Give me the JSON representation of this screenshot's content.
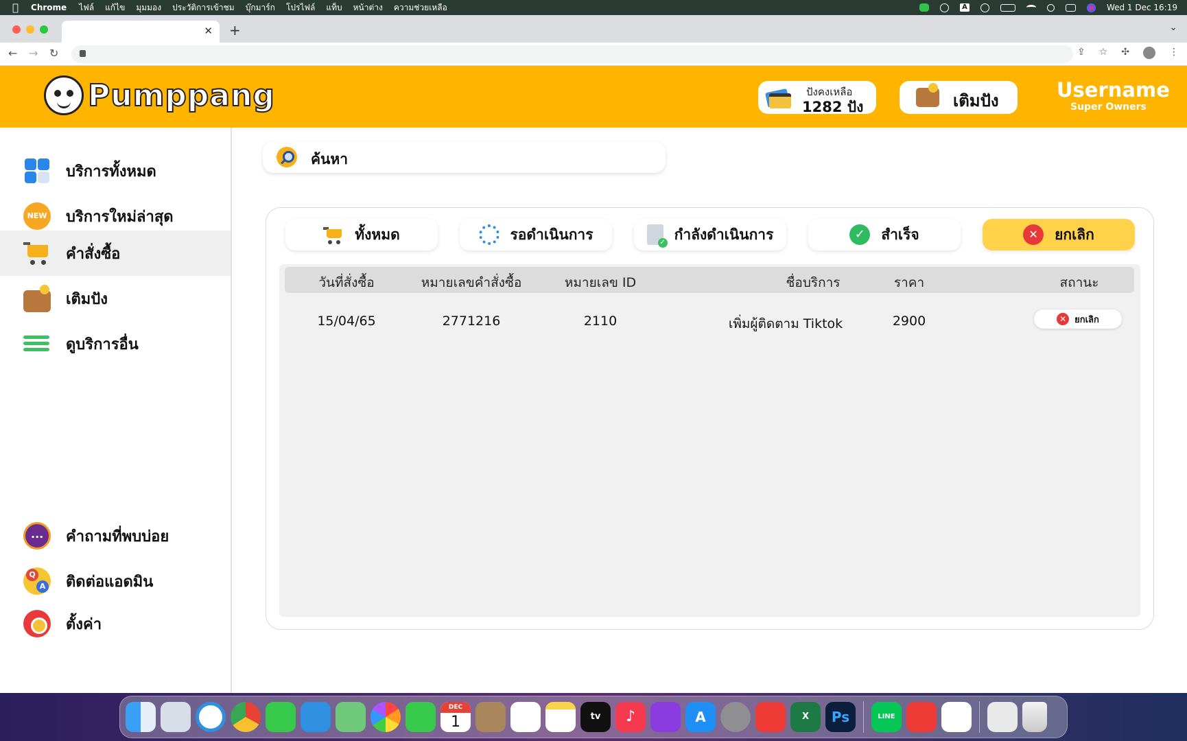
{
  "menubar": {
    "app_name": "Chrome",
    "items": [
      "ไฟล์",
      "แก้ไข",
      "มุมมอง",
      "ประวัติการเข้าชม",
      "บุ๊กมาร์ก",
      "โปรไฟล์",
      "แท็บ",
      "หน้าต่าง",
      "ความช่วยเหลือ"
    ],
    "datetime": "Wed 1 Dec  16:19",
    "input_source": "A"
  },
  "browser": {
    "tab_title": "",
    "url": ""
  },
  "header": {
    "brand": "Pumppang",
    "balance_label": "ปังคงเหลือ",
    "balance_value": "1282 ปัง",
    "topup_label": "เติมปัง",
    "username": "Username",
    "role": "Super Owners",
    "accent_color": "#ffb400"
  },
  "sidebar": {
    "items": [
      {
        "label": "บริการทั้งหมด",
        "icon": "grid-icon"
      },
      {
        "label": "บริการใหม่ล่าสุด",
        "icon": "new-badge-icon",
        "badge": "NEW"
      },
      {
        "label": "คำสั่งซื้อ",
        "icon": "cart-icon",
        "active": true
      },
      {
        "label": "เติมปัง",
        "icon": "wallet-icon"
      },
      {
        "label": "ดูบริการอื่น",
        "icon": "list-icon"
      }
    ],
    "bottom_items": [
      {
        "label": "คำถามที่พบบ่อย",
        "icon": "chat-bubble-icon"
      },
      {
        "label": "ติดต่อแอดมิน",
        "icon": "qa-icon"
      },
      {
        "label": "ตั้งค่า",
        "icon": "gear-icon"
      }
    ]
  },
  "search": {
    "label": "ค้นหา"
  },
  "filters": [
    {
      "label": "ทั้งหมด",
      "icon": "cart-icon"
    },
    {
      "label": "รอดำเนินการ",
      "icon": "spinner-icon"
    },
    {
      "label": "กำลังดำเนินการ",
      "icon": "checklist-icon"
    },
    {
      "label": "สำเร็จ",
      "icon": "check-circle-icon"
    },
    {
      "label": "ยกเลิก",
      "icon": "cancel-icon",
      "active": true
    }
  ],
  "table": {
    "columns": [
      "วันที่สั่งซื้อ",
      "หมายเลขคำสั่งซื้อ",
      "หมายเลข ID",
      "ชื่อบริการ",
      "ราคา",
      "สถานะ"
    ],
    "rows": [
      {
        "date": "15/04/65",
        "order_no": "2771216",
        "id": "2110",
        "service": "เพิ่มผู้ติดตาม Tiktok",
        "price": "2900",
        "status": "ยกเลิก"
      }
    ]
  },
  "dock": {
    "calendar_month": "DEC",
    "calendar_day": "1",
    "tv_label": "tv",
    "ps_label": "Ps",
    "line_label": "LINE",
    "apps": [
      "finder",
      "launchpad",
      "safari",
      "chrome",
      "messages",
      "mail",
      "maps",
      "photos",
      "facetime",
      "calendar",
      "contacts",
      "reminders",
      "notes",
      "tv",
      "music",
      "podcasts",
      "app-store",
      "system-preferences",
      "anydesk",
      "excel",
      "photoshop",
      "line",
      "anydesk",
      "textedit",
      "preview",
      "trash"
    ]
  }
}
